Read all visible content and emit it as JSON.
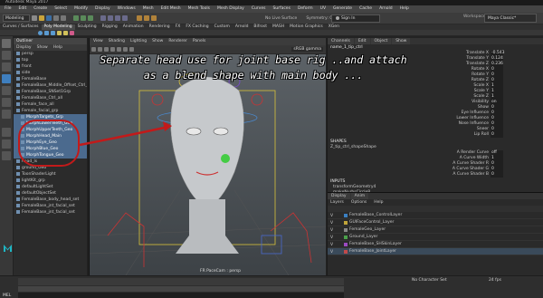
{
  "window": {
    "title": "Autodesk Maya 2017"
  },
  "menubar": {
    "items": [
      "File",
      "Edit",
      "Create",
      "Select",
      "Modify",
      "Display",
      "Windows",
      "Mesh",
      "Edit Mesh",
      "Mesh Tools",
      "Mesh Display",
      "Curves",
      "Surfaces",
      "Deform",
      "UV",
      "Generate",
      "Cache",
      "Arnold",
      "Help"
    ]
  },
  "statusbar": {
    "mode": "Modeling",
    "live_surface": "No Live Surface",
    "symmetry": "Symmetry: Off",
    "sign_in": "Sign In"
  },
  "workspace": {
    "label": "Workspace :",
    "value": "Maya Classic*"
  },
  "shelf": {
    "tabs": [
      "Curves / Surfaces",
      "Poly Modeling",
      "Sculpting",
      "Rigging",
      "Animation",
      "Rendering",
      "FX",
      "FX Caching",
      "Custom",
      "Arnold",
      "Bifrost",
      "MASH",
      "Motion Graphics",
      "XGen"
    ]
  },
  "outliner": {
    "title": "Outliner",
    "menu": [
      "Display",
      "Show",
      "Help"
    ],
    "items": [
      {
        "label": "persp"
      },
      {
        "label": "top"
      },
      {
        "label": "front"
      },
      {
        "label": "side"
      },
      {
        "label": "FemaleBase"
      },
      {
        "label": "FemaleBase_Middle_Offset_Ctrl_Nod"
      },
      {
        "label": "FemaleBase_SNSet1Grp"
      },
      {
        "label": "FemaleBase_Ctrl_all"
      },
      {
        "label": "Female_face_all"
      },
      {
        "label": "Female_facial_grp"
      },
      {
        "label": "MorphTargets_Grp"
      },
      {
        "label": "MorphLowerTeeth_Geo"
      },
      {
        "label": "MorphUpperTeeth_Geo"
      },
      {
        "label": "MorphHead_Main"
      },
      {
        "label": "MorphEye_Geo"
      },
      {
        "label": "MorphBlue_Geo"
      },
      {
        "label": "MorphTongue_Geo"
      },
      {
        "label": "head_ls"
      },
      {
        "label": "ground_Geo"
      },
      {
        "label": "ToonShaderLight"
      },
      {
        "label": "lightKit_grp"
      },
      {
        "label": "defaultLightSet"
      },
      {
        "label": "defaultObjectSet"
      },
      {
        "label": "FemaleBase_body_head_set"
      },
      {
        "label": "FemaleBase_jnt_facial_set"
      },
      {
        "label": "FemaleBase_jnt_facial_set"
      }
    ]
  },
  "viewport": {
    "menu": [
      "View",
      "Shading",
      "Lighting",
      "Show",
      "Renderer",
      "Panels"
    ],
    "camera_label": "FR PaceCam : persp",
    "srgb": "sRGB gamma"
  },
  "caption": {
    "line1": "Separate head use for joint base rig ..and attach",
    "line2": "as a blend shape with main body ..."
  },
  "channel_box": {
    "tabs": [
      "Channels",
      "Edit",
      "Object",
      "Show"
    ],
    "object": "name_1_tip_ctrl",
    "channels": [
      {
        "name": "Translate X",
        "value": "-0.543"
      },
      {
        "name": "Translate Y",
        "value": "0.124"
      },
      {
        "name": "Translate Z",
        "value": "0.236"
      },
      {
        "name": "Rotate X",
        "value": "0"
      },
      {
        "name": "Rotate Y",
        "value": "0"
      },
      {
        "name": "Rotate Z",
        "value": "0"
      },
      {
        "name": "Scale X",
        "value": "1"
      },
      {
        "name": "Scale Y",
        "value": "1"
      },
      {
        "name": "Scale Z",
        "value": "1"
      },
      {
        "name": "Visibility",
        "value": "on"
      },
      {
        "name": "Show",
        "value": "0"
      },
      {
        "name": "Eye Influence",
        "value": "0"
      },
      {
        "name": "Lower Influence",
        "value": "0"
      },
      {
        "name": "Nose Influence",
        "value": "0"
      },
      {
        "name": "Sneer",
        "value": "0"
      },
      {
        "name": "Lip Roll",
        "value": "0"
      }
    ],
    "shapes_header": "SHAPES",
    "shape_name": "Z_tip_ctrl_shapeShape",
    "shape_channels": [
      {
        "name": "A Render Curve",
        "value": "off"
      },
      {
        "name": "A Curve Width",
        "value": "1"
      },
      {
        "name": "A Curve Shader R",
        "value": "0"
      },
      {
        "name": "A Curve Shader G",
        "value": "0"
      },
      {
        "name": "A Curve Shader B",
        "value": "0"
      }
    ],
    "inputs_header": "INPUTS",
    "inputs": [
      "transformGeometry4",
      "makeNurbsCircle8"
    ]
  },
  "layer_editor": {
    "tabs": [
      "Display",
      "Anim"
    ],
    "menu": [
      "Layers",
      "Options",
      "Help"
    ],
    "layers": [
      {
        "name": "FemaleBase_ControlLayer",
        "color": "#3a7fc1"
      },
      {
        "name": "GUIFaceControl_Layer",
        "color": "#c1a53a"
      },
      {
        "name": "FemaleGeo_Layer",
        "color": "#888888"
      },
      {
        "name": "Ground_Layer",
        "color": "#4aa14a"
      },
      {
        "name": "FemaleBase_SHSkinLayer",
        "color": "#9b4ac1"
      },
      {
        "name": "FemaleBase_JointLayer",
        "color": "#c14a4a"
      }
    ]
  },
  "command_line": {
    "mel_label": "MEL",
    "right_label": "No Character Set",
    "fps": "24 fps"
  },
  "colors": {
    "accent": "#c21a1a",
    "maya_logo": "#1fb6c4"
  }
}
